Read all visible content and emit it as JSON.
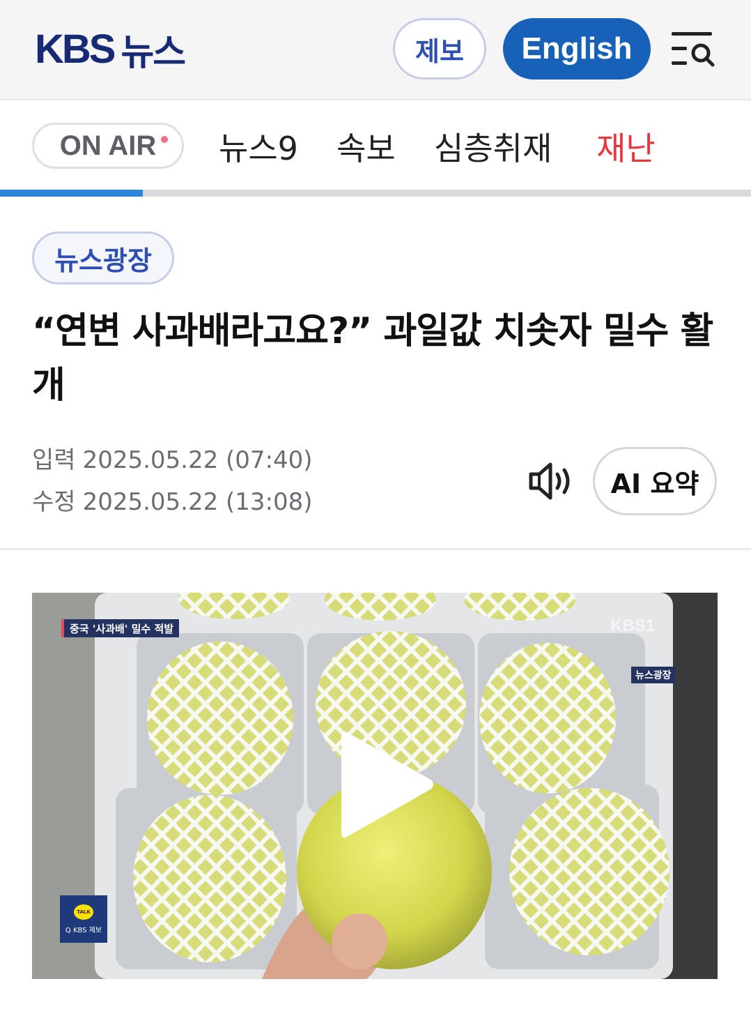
{
  "header": {
    "logo_text": "KBS",
    "logo_kr": "뉴스",
    "report_label": "제보",
    "english_label": "English",
    "menu_icon": "menu-search-icon",
    "colors": {
      "brand": "#172a73",
      "english_bg": "#1762b8",
      "report_text": "#2d4fb3"
    }
  },
  "nav": {
    "onair_label": "ON AIR",
    "items": [
      "뉴스9",
      "속보",
      "심층취재",
      "재난"
    ],
    "alert_color": "#e8363f",
    "progress_fraction": 0.19
  },
  "article": {
    "category": "뉴스광장",
    "headline": "“연변 사과배라고요?” 과일값 치솟자 밀수 활개",
    "input_label": "입력",
    "input_date": "2025.05.22 (07:40)",
    "modified_label": "수정",
    "modified_date": "2025.05.22 (13:08)",
    "speaker_icon": "speaker-icon",
    "ai_summary_label": "AI 요약"
  },
  "video": {
    "caption_tag": "중국 '사과배' 밀수 적발",
    "channel_mark": "KBS1",
    "program_tag": "뉴스광장",
    "talk_bubble": "TALK",
    "talk_label": "Q KBS 제보",
    "play_icon": "play-icon"
  }
}
